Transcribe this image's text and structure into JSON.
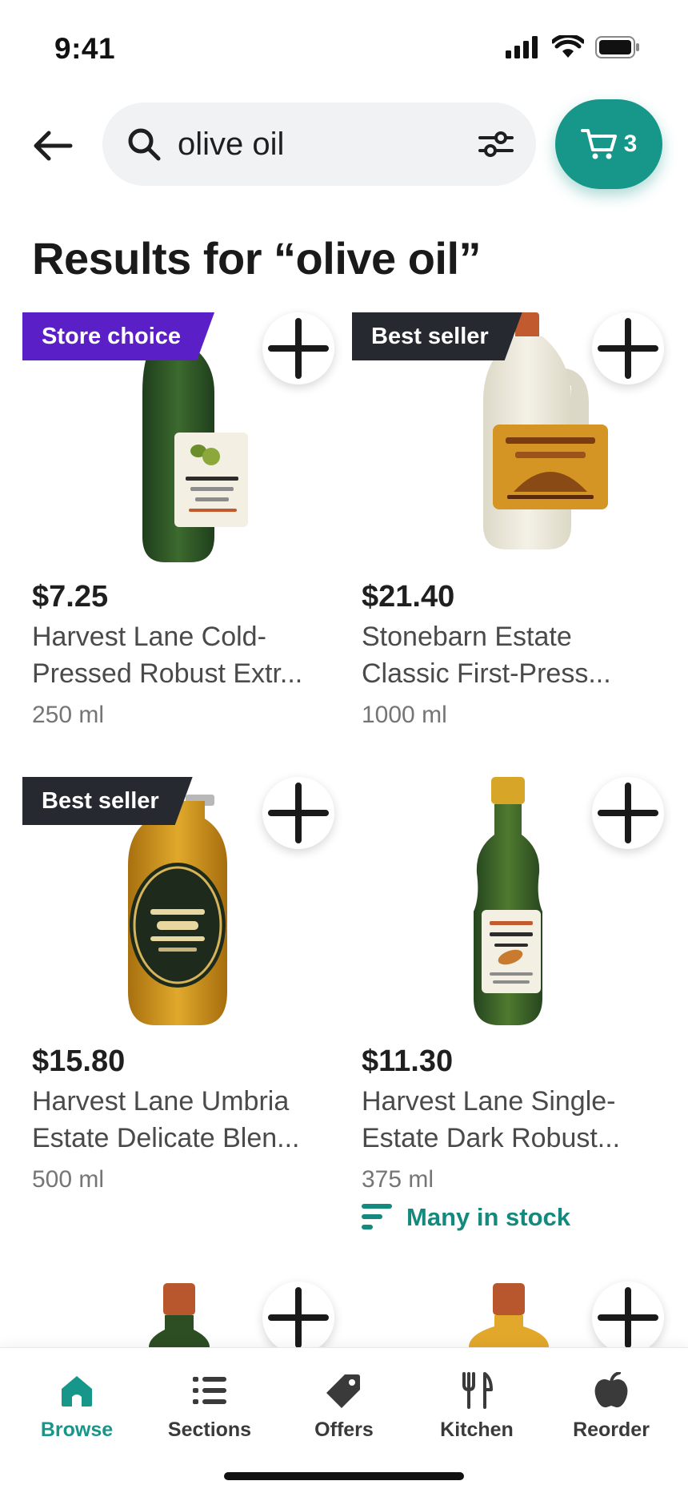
{
  "status_bar": {
    "time": "9:41"
  },
  "search": {
    "query": "olive oil"
  },
  "cart": {
    "count": "3"
  },
  "results_title": "Results for “olive oil”",
  "products": [
    {
      "badge": "Store choice",
      "badge_color": "#5a1fc6",
      "price": "$7.25",
      "name_line1": "Harvest Lane Cold-",
      "name_line2": "Pressed Robust Extr...",
      "size": "250 ml"
    },
    {
      "badge": "Best seller",
      "badge_color": "#262a30",
      "price": "$21.40",
      "name_line1": "Stonebarn Estate",
      "name_line2": "Classic First-Press...",
      "size": "1000 ml"
    },
    {
      "badge": "Best seller",
      "badge_color": "#262a30",
      "price": "$15.80",
      "name_line1": "Harvest Lane Umbria",
      "name_line2": "Estate Delicate Blen...",
      "size": "500 ml"
    },
    {
      "price": "$11.30",
      "name_line1": "Harvest Lane Single-",
      "name_line2": "Estate Dark Robust...",
      "size": "375 ml",
      "stock": "Many in stock"
    }
  ],
  "bottom_nav": [
    {
      "label": "Browse",
      "icon": "home-icon",
      "active": true
    },
    {
      "label": "Sections",
      "icon": "list-icon",
      "active": false
    },
    {
      "label": "Offers",
      "icon": "tag-icon",
      "active": false
    },
    {
      "label": "Kitchen",
      "icon": "fork-knife-icon",
      "active": false
    },
    {
      "label": "Reorder",
      "icon": "apple-icon",
      "active": false
    }
  ],
  "colors": {
    "accent": "#17968a",
    "store_choice": "#5a1fc6",
    "badge_dark": "#262a30"
  }
}
